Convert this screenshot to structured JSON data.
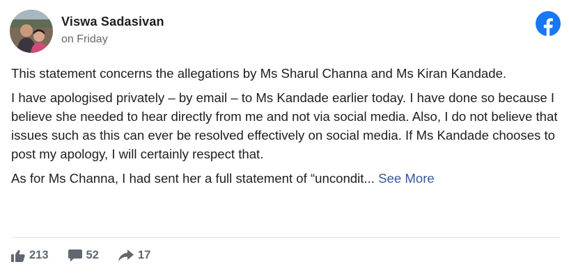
{
  "post": {
    "author": "Viswa Sadasivan",
    "time": "on Friday",
    "paragraphs": [
      "This statement concerns the allegations by Ms Sharul Channa and Ms Kiran Kandade.",
      "I have apologised privately – by email – to Ms Kandade earlier today. I have done so because I believe she needed to hear directly from me and not via social media. Also, I do not believe that issues such as this can ever be resolved effectively on social media. If Ms Kandade chooses to post my apology, I will certainly respect that.",
      "As for Ms Channa, I had sent her a full statement of “uncondit..."
    ],
    "see_more": "See More"
  },
  "reactions": {
    "likes": "213",
    "comments": "52",
    "shares": "17"
  },
  "icons": {
    "brand": "facebook-logo-icon",
    "like": "thumbs-up-icon",
    "comment": "comment-bubble-icon",
    "share": "share-arrow-icon"
  },
  "colors": {
    "facebook_blue": "#1877f2",
    "link": "#385898",
    "muted": "#65676b",
    "action_gray": "#606770"
  }
}
